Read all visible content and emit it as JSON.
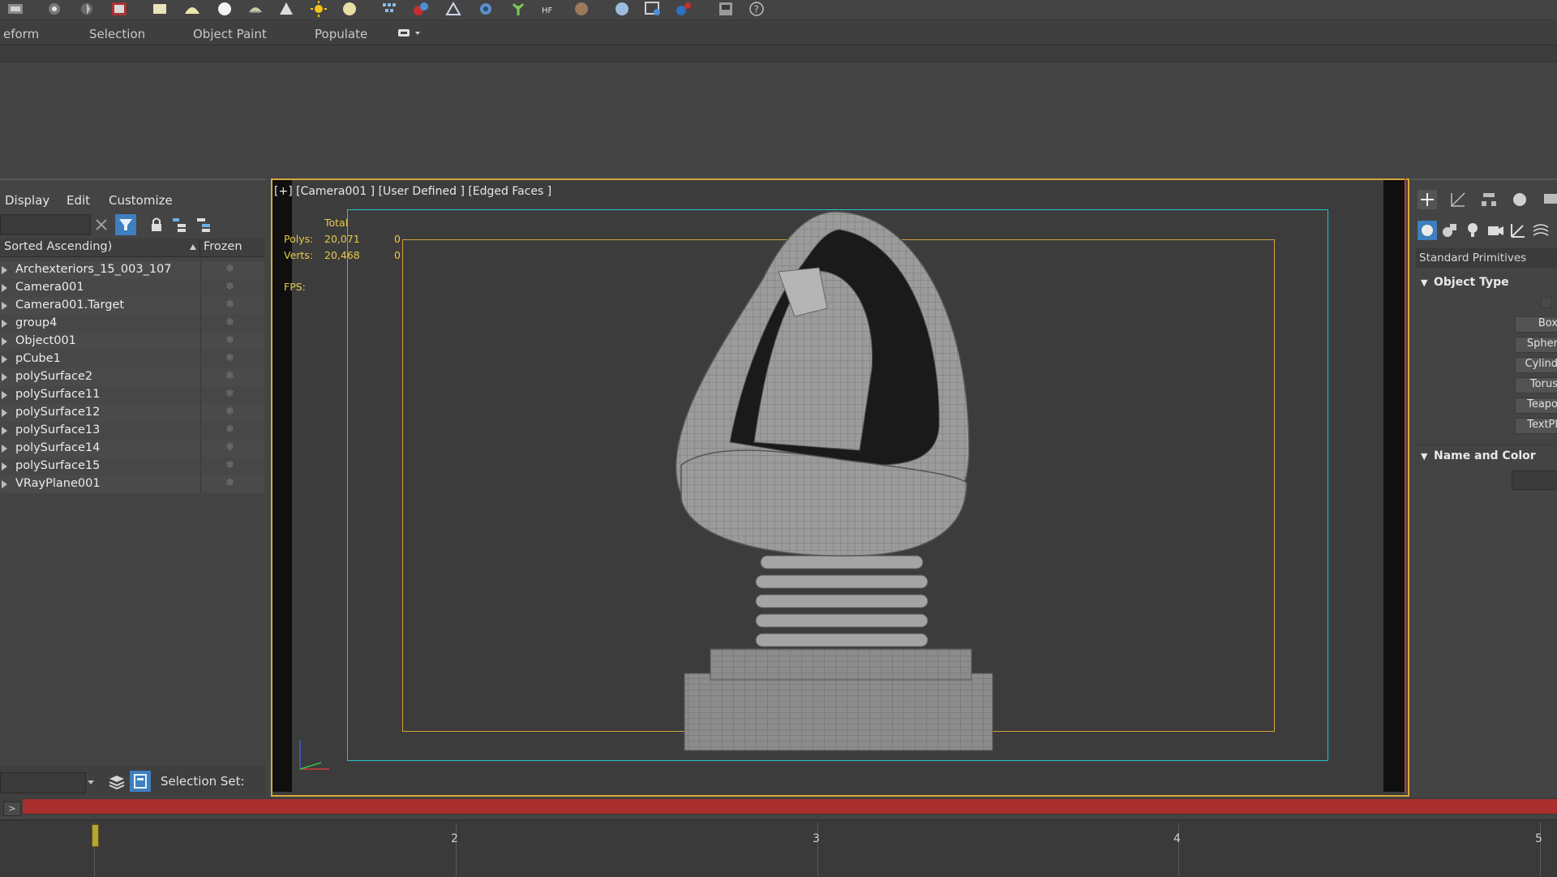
{
  "ribbon": {
    "tabs": [
      "eform",
      "Selection",
      "Object Paint",
      "Populate"
    ]
  },
  "scene_explorer": {
    "menu": [
      "Display",
      "Edit",
      "Customize"
    ],
    "sort_label": "Sorted Ascending)",
    "frozen_label": "Frozen",
    "objects": [
      "Archexteriors_15_003_107",
      "Camera001",
      "Camera001.Target",
      "group4",
      "Object001",
      "pCube1",
      "polySurface2",
      "polySurface11",
      "polySurface12",
      "polySurface13",
      "polySurface14",
      "polySurface15",
      "VRayPlane001"
    ],
    "selection_set_label": "Selection Set:"
  },
  "viewport": {
    "label": "[+] [Camera001 ] [User Defined ] [Edged Faces ]",
    "stats": {
      "total_label": "Total",
      "polys_label": "Polys:",
      "polys_value": "20,071",
      "polys_sel": "0",
      "verts_label": "Verts:",
      "verts_value": "20,468",
      "verts_sel": "0",
      "fps_label": "FPS:"
    },
    "colors": {
      "safe_frame": "#2cc0c8",
      "action_frame": "#d4a33a",
      "active_border": "#d5a93a"
    }
  },
  "command_panel": {
    "category": "Standard Primitives",
    "object_type_label": "Object Type",
    "object_buttons": [
      "Box",
      "Spher",
      "Cylind",
      "Torus",
      "Teapo",
      "TextPl"
    ],
    "name_color_label": "Name and Color"
  },
  "timeline": {
    "play_label": ">",
    "ticks": [
      "2",
      "3",
      "4",
      "5"
    ]
  }
}
